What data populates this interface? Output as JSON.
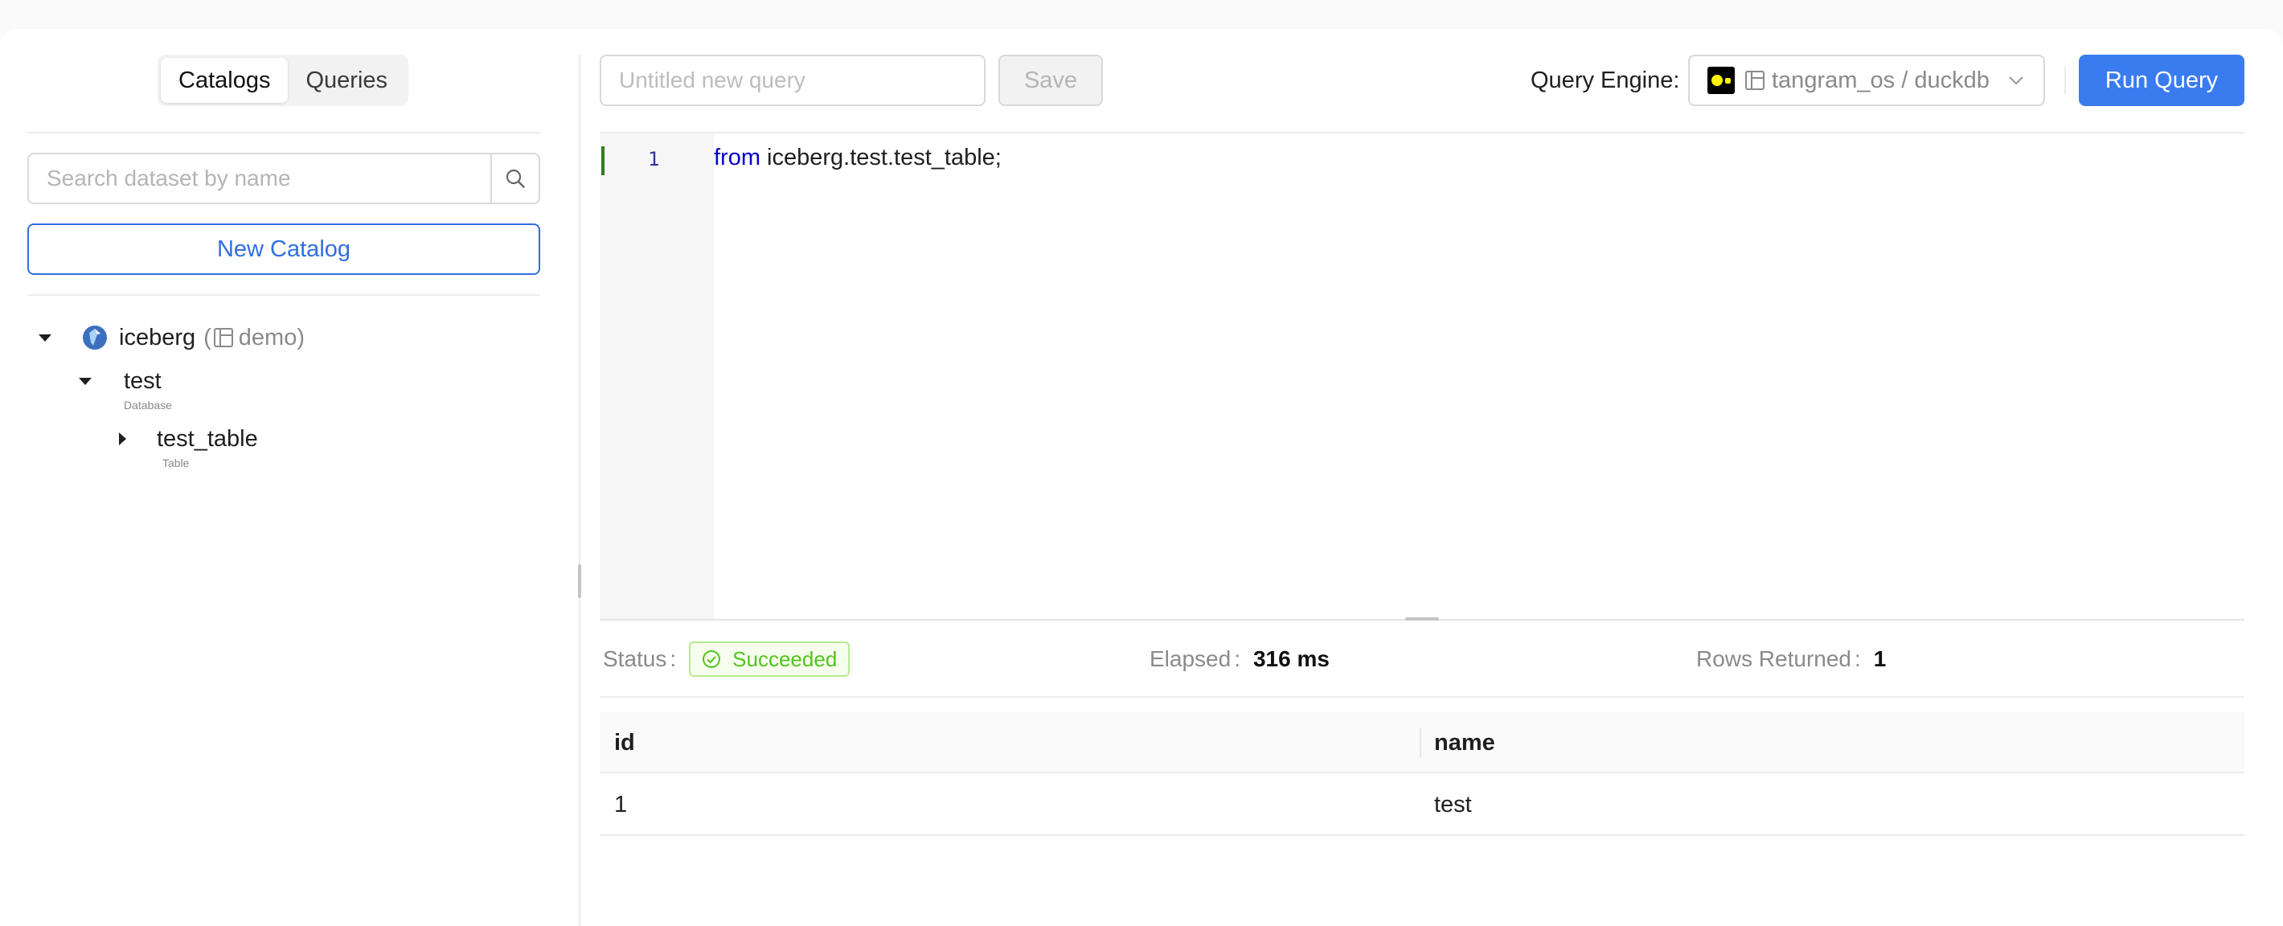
{
  "sidebar": {
    "tabs": [
      {
        "label": "Catalogs",
        "active": true
      },
      {
        "label": "Queries",
        "active": false
      }
    ],
    "search": {
      "placeholder": "Search dataset by name",
      "value": ""
    },
    "new_catalog_label": "New Catalog",
    "tree": {
      "catalog": {
        "name": "iceberg",
        "open_paren": "(",
        "warehouse": "demo",
        "close_paren": ")"
      },
      "database": {
        "name": "test",
        "type": "Database"
      },
      "table": {
        "name": "test_table",
        "type": "Table"
      }
    }
  },
  "toolbar": {
    "query_name_placeholder": "Untitled new query",
    "query_name_value": "",
    "save_label": "Save",
    "engine_label": "Query Engine:",
    "engine_value": "tangram_os / duckdb",
    "run_label": "Run Query"
  },
  "editor": {
    "line_number": "1",
    "keyword": "from",
    "code_rest": " iceberg.test.test_table;"
  },
  "results": {
    "status_label": "Status",
    "status_value": "Succeeded",
    "elapsed_label": "Elapsed",
    "elapsed_value": "316 ms",
    "rows_label": "Rows Returned",
    "rows_value": "1",
    "colon": ":",
    "columns": [
      "id",
      "name"
    ],
    "rows": [
      [
        "1",
        "test"
      ]
    ]
  },
  "colors": {
    "accent": "#3a7cf0",
    "success": "#52c41a",
    "keyword": "#0000cc"
  }
}
